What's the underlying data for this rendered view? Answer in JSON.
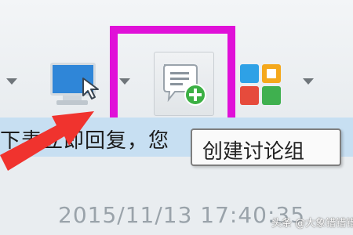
{
  "toolbar": {
    "buttons": [
      {
        "name": "remote-desktop",
        "icon": "monitor-cursor-icon"
      },
      {
        "name": "create-discussion-group",
        "icon": "chat-plus-icon"
      },
      {
        "name": "apps",
        "icon": "app-grid-icon"
      }
    ],
    "highlight_color": "#e010d8"
  },
  "message": {
    "text": "下表立即回复，您"
  },
  "tooltip": {
    "text": "创建讨论组"
  },
  "timestamp": "2015/11/13 17:40:35",
  "watermark": "头条 @大象错错错",
  "colors": {
    "accent_blue": "#2f86d8",
    "arrow_red": "#f0332e",
    "plus_green": "#3cb044",
    "message_bg": "#c7dff2"
  }
}
